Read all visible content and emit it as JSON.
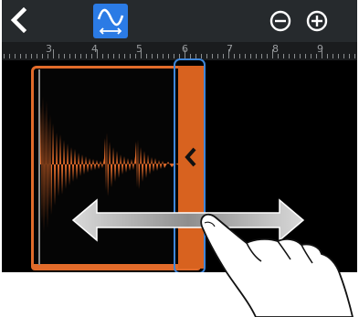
{
  "toolbar": {
    "back_icon": "chevron-left-icon",
    "mode_icon": "waveform-resize-icon",
    "zoom_out_icon": "zoom-out-icon",
    "zoom_in_icon": "zoom-in-icon"
  },
  "ruler": {
    "labels": [
      "3",
      "4",
      "5",
      "6",
      "7",
      "8",
      "9"
    ]
  },
  "colors": {
    "topbar": "#262a2d",
    "accent_blue": "#2b7be5",
    "region_orange": "#e26b2a",
    "selection_outline": "#3f86d9"
  },
  "gesture": {
    "type": "drag",
    "direction": "left-right",
    "icon": "hand-pointer-icon"
  }
}
